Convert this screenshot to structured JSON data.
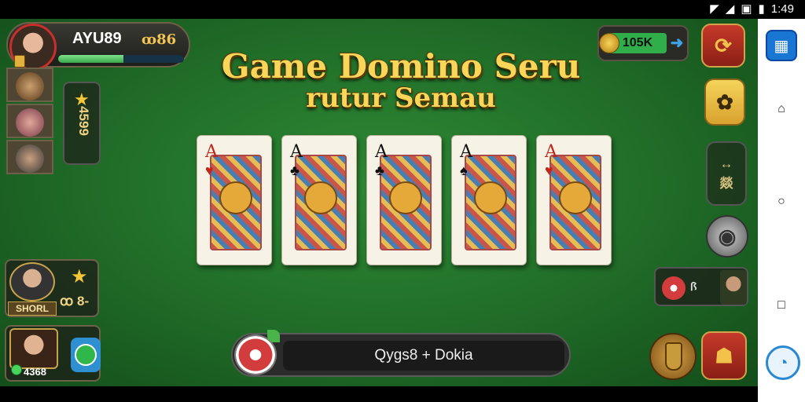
{
  "status_bar": {
    "time": "1:49",
    "icons": [
      "wifi-icon",
      "signal-icon",
      "battery-icon",
      "notification-icon"
    ]
  },
  "player": {
    "name": "AYU89",
    "level": "ꝏ86",
    "xp_fraction": 0.52
  },
  "stars_panel": {
    "value": "4599"
  },
  "title": {
    "line1": "Game Domino Seru",
    "line2": "rutur Semau"
  },
  "cards": [
    {
      "rank": "A",
      "suit": "♥",
      "suit_color": "#c0261c"
    },
    {
      "rank": "A",
      "suit": "♣",
      "suit_color": "#111111"
    },
    {
      "rank": "A",
      "suit": "♣",
      "suit_color": "#111111"
    },
    {
      "rank": "A",
      "suit": "♠",
      "suit_color": "#111111"
    },
    {
      "rank": "A",
      "suit": "♥",
      "suit_color": "#c0261c"
    }
  ],
  "coins": {
    "value": "105K"
  },
  "resize_btn": {
    "label": "燚"
  },
  "chips_panel": {
    "text": "ꟗ"
  },
  "player2": {
    "name": "SHORL",
    "score": "ꝏ 8-"
  },
  "player3": {
    "score": "4368"
  },
  "chat": {
    "text": "Qygs8 + Dokia"
  },
  "colors": {
    "table_green": "#1f6b27",
    "title_gold": "#f7d65a",
    "coin_green": "#2fae4a",
    "accent_red": "#c63a2a"
  }
}
